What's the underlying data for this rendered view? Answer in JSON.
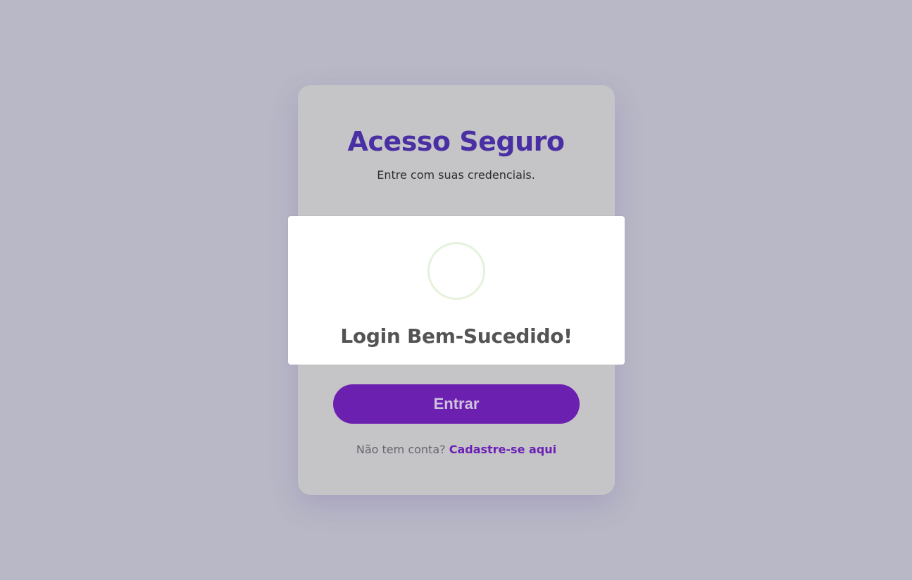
{
  "login_card": {
    "title": "Acesso Seguro",
    "subtitle": "Entre com suas credenciais.",
    "submit_label": "Entrar",
    "signup_prompt": "Não tem conta?",
    "signup_link": "Cadastre-se aqui"
  },
  "success_modal": {
    "icon": "success-circle-icon",
    "title": "Login Bem-Sucedido!"
  },
  "colors": {
    "background": "#b8b8c6",
    "card": "#c5c5c7",
    "accent": "#6b20b0",
    "title": "#4a2ea3",
    "success_ring": "#e4f2db"
  }
}
